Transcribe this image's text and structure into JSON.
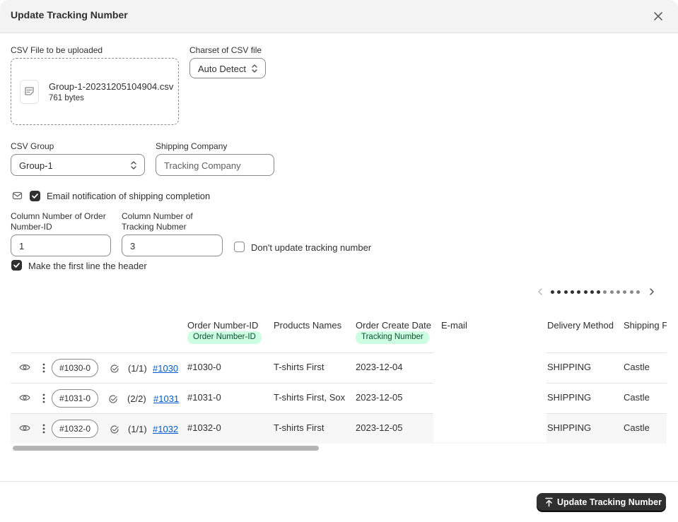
{
  "dialog": {
    "title": "Update Tracking Number"
  },
  "upload": {
    "label": "CSV File to be uploaded",
    "file_name": "Group-1-20231205104904.csv",
    "file_size": "761 bytes"
  },
  "charset": {
    "label": "Charset of CSV file",
    "value": "Auto Detect"
  },
  "csv_group": {
    "label": "CSV Group",
    "value": "Group-1"
  },
  "shipping_company": {
    "label": "Shipping Company",
    "placeholder": "Tracking Company"
  },
  "email_notification": {
    "label": "Email notification of shipping completion",
    "checked": true
  },
  "order_column": {
    "label_line1": "Column Number of Order",
    "label_line2": "Number-ID",
    "value": "1"
  },
  "tracking_column": {
    "label_line1": "Column Number of",
    "label_line2": "Tracking Nubmer",
    "value": "3"
  },
  "dont_update": {
    "label": "Don't update tracking number",
    "checked": false
  },
  "first_line_header": {
    "label": "Make the first line the header",
    "checked": true
  },
  "pager": {
    "total_dots": 14,
    "current_index": 7
  },
  "table": {
    "columns": [
      "Order Number-ID",
      "Products Names",
      "Order Create Date",
      "E-mail",
      "Delivery Method",
      "Shipping F"
    ],
    "badges": {
      "order": "Order Number-ID",
      "tracking": "Tracking Number"
    },
    "rows": [
      {
        "pill": "#1030-0",
        "count": "(1/1)",
        "link": "#1030",
        "order_id": "#1030-0",
        "products": "T-shirts First",
        "date": "2023-12-04",
        "delivery": "SHIPPING",
        "shipping": "Castle"
      },
      {
        "pill": "#1031-0",
        "count": "(2/2)",
        "link": "#1031",
        "order_id": "#1031-0",
        "products": "T-shirts First, Sox",
        "date": "2023-12-05",
        "delivery": "SHIPPING",
        "shipping": "Castle"
      },
      {
        "pill": "#1032-0",
        "count": "(1/1)",
        "link": "#1032",
        "order_id": "#1032-0",
        "products": "T-shirts First",
        "date": "2023-12-05",
        "delivery": "SHIPPING",
        "shipping": "Castle"
      }
    ]
  },
  "footer": {
    "primary_label": "Update Tracking Number"
  },
  "icons": [
    "close-icon",
    "file-icon",
    "select-arrows-icon",
    "mail-icon",
    "checkmark-icon",
    "eye-icon",
    "more-vertical-icon",
    "check-circle-icon",
    "chevron-left-icon",
    "chevron-right-icon",
    "upload-icon"
  ],
  "colors": {
    "primary": "#303030",
    "badge_bg": "#cdfee1",
    "badge_text": "#0c5132",
    "link": "#005bd3"
  }
}
